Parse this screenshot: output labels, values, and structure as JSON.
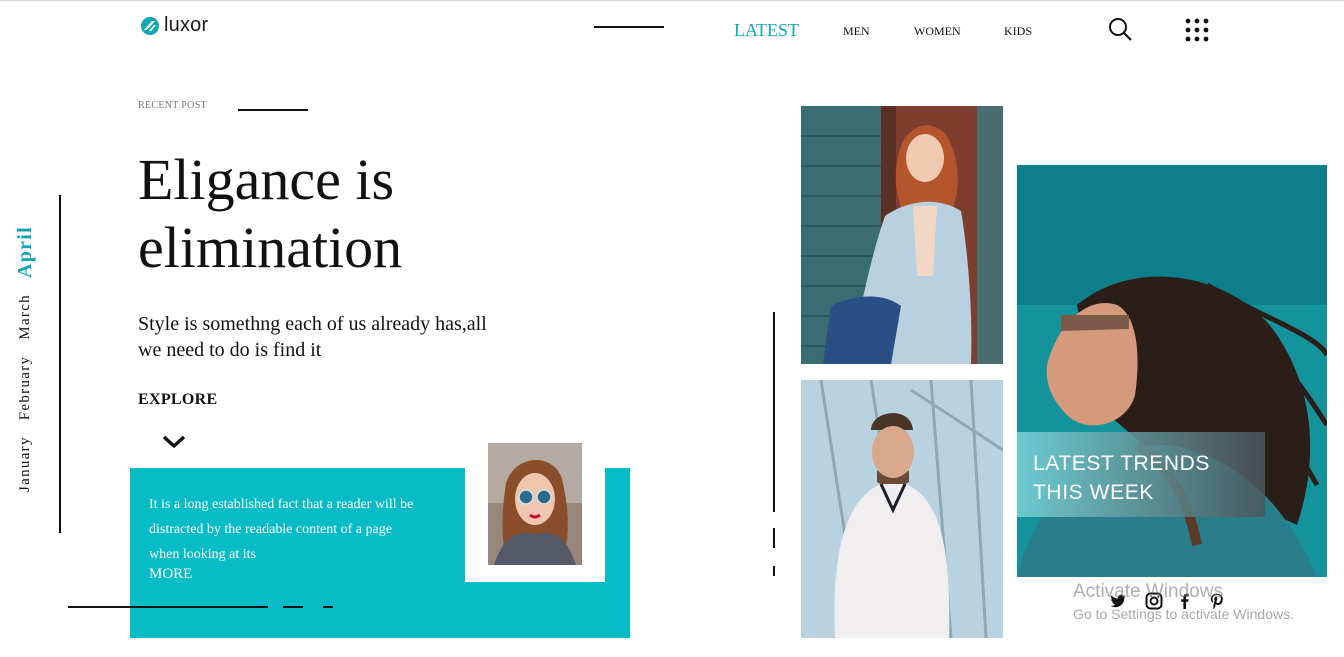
{
  "brand": {
    "name": "luxor",
    "accent": "#12a6b5"
  },
  "nav": {
    "items": [
      "LATEST",
      "MEN",
      "WOMEN",
      "KIDS"
    ],
    "active": "LATEST",
    "icons": [
      "search-icon",
      "grid-menu-icon"
    ]
  },
  "months": [
    "January",
    "February",
    "March",
    "April"
  ],
  "active_month": "April",
  "hero": {
    "eyebrow": "RECENT POST",
    "title_line1": "Eligance is",
    "title_line2": "elimination",
    "subtitle_line1": "Style is somethng each of us already has,all",
    "subtitle_line2": "we need to do is find it",
    "cta": "EXPLORE"
  },
  "card": {
    "text_line1": "It is a long established fact that a reader will be",
    "text_line2": "distracted by the readable content of a page",
    "text_line3": "when looking at its",
    "more": "MORE",
    "color": "#07bcc6"
  },
  "trend": {
    "line1": "LATEST TRENDS",
    "line2": "THIS WEEK"
  },
  "social": [
    "twitter-icon",
    "instagram-icon",
    "facebook-icon",
    "pinterest-icon"
  ],
  "watermark": {
    "title": "Activate Windows",
    "subtitle": "Go to Settings to activate Windows."
  }
}
